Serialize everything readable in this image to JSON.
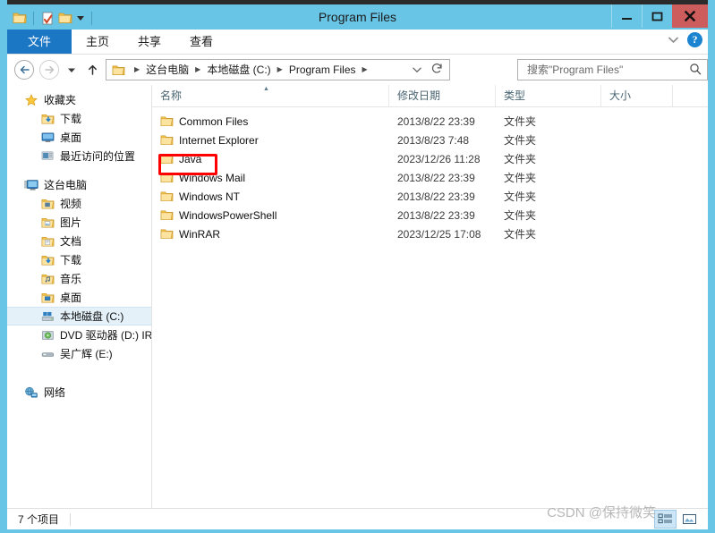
{
  "window": {
    "title": "Program Files",
    "quick_access": [
      {
        "icon": "folder-icon",
        "name": "qat-folder"
      },
      {
        "icon": "properties-icon",
        "name": "qat-properties"
      },
      {
        "icon": "new-folder-icon",
        "name": "qat-new-folder"
      },
      {
        "icon": "chevron-down-icon",
        "name": "qat-customize"
      }
    ],
    "controls": {
      "minimize": "—",
      "maximize": "□",
      "close": "✕"
    },
    "colors": {
      "titlebar": "#68c5e6",
      "file_tab": "#1b76c4",
      "close_button": "#cd5c5c",
      "highlight_box": "#ff0000",
      "selection": "#e4f1f9"
    }
  },
  "ribbon": {
    "tabs": [
      {
        "label": "文件",
        "active": true
      },
      {
        "label": "主页",
        "active": false
      },
      {
        "label": "共享",
        "active": false
      },
      {
        "label": "查看",
        "active": false
      }
    ],
    "expand_icon": "chevron-down-icon",
    "help_icon": "help-icon",
    "help_label": "?"
  },
  "address_bar": {
    "back": "←",
    "forward": "→",
    "recent_dropdown": "▼",
    "up": "↑",
    "breadcrumbs": [
      "这台电脑",
      "本地磁盘 (C:)",
      "Program Files"
    ],
    "separator": "▶",
    "history_dropdown": "⌄",
    "refresh": "↻"
  },
  "search": {
    "placeholder": "搜索\"Program Files\"",
    "value": "",
    "icon": "search-icon"
  },
  "sidebar": {
    "groups": [
      {
        "root": {
          "label": "收藏夹",
          "icon": "star-icon"
        },
        "items": [
          {
            "label": "下载",
            "icon": "downloads-folder-icon"
          },
          {
            "label": "桌面",
            "icon": "desktop-icon"
          },
          {
            "label": "最近访问的位置",
            "icon": "recent-places-icon"
          }
        ]
      },
      {
        "root": {
          "label": "这台电脑",
          "icon": "this-pc-icon"
        },
        "items": [
          {
            "label": "视频",
            "icon": "videos-folder-icon"
          },
          {
            "label": "图片",
            "icon": "pictures-folder-icon"
          },
          {
            "label": "文档",
            "icon": "documents-folder-icon"
          },
          {
            "label": "下载",
            "icon": "downloads-folder-icon"
          },
          {
            "label": "音乐",
            "icon": "music-folder-icon"
          },
          {
            "label": "桌面",
            "icon": "desktop-folder-icon"
          },
          {
            "label": "本地磁盘 (C:)",
            "icon": "drive-icon",
            "selected": true
          },
          {
            "label": "DVD 驱动器 (D:) IR",
            "icon": "dvd-drive-icon"
          },
          {
            "label": "吴广辉 (E:)",
            "icon": "removable-drive-icon"
          }
        ]
      },
      {
        "root": {
          "label": "网络",
          "icon": "network-icon"
        },
        "items": []
      }
    ]
  },
  "file_list": {
    "columns": [
      {
        "label": "名称",
        "sorted": true,
        "sort_dir": "asc"
      },
      {
        "label": "修改日期"
      },
      {
        "label": "类型"
      },
      {
        "label": "大小"
      }
    ],
    "rows": [
      {
        "name": "Common Files",
        "date": "2013/8/22 23:39",
        "type": "文件夹",
        "size": "",
        "icon": "folder-icon"
      },
      {
        "name": "Internet Explorer",
        "date": "2013/8/23 7:48",
        "type": "文件夹",
        "size": "",
        "icon": "folder-icon"
      },
      {
        "name": "Java",
        "date": "2023/12/26 11:28",
        "type": "文件夹",
        "size": "",
        "icon": "folder-icon",
        "highlighted": true
      },
      {
        "name": "Windows Mail",
        "date": "2013/8/22 23:39",
        "type": "文件夹",
        "size": "",
        "icon": "folder-icon"
      },
      {
        "name": "Windows NT",
        "date": "2013/8/22 23:39",
        "type": "文件夹",
        "size": "",
        "icon": "folder-icon"
      },
      {
        "name": "WindowsPowerShell",
        "date": "2013/8/22 23:39",
        "type": "文件夹",
        "size": "",
        "icon": "folder-icon"
      },
      {
        "name": "WinRAR",
        "date": "2023/12/25 17:08",
        "type": "文件夹",
        "size": "",
        "icon": "folder-icon"
      }
    ]
  },
  "status_bar": {
    "item_count": "7 个项目",
    "view_buttons": [
      {
        "name": "details-view-button",
        "icon": "details-view-icon",
        "active": true
      },
      {
        "name": "large-icons-view-button",
        "icon": "large-icons-view-icon",
        "active": false
      }
    ]
  },
  "watermark": {
    "text": "CSDN @保持微笑"
  }
}
